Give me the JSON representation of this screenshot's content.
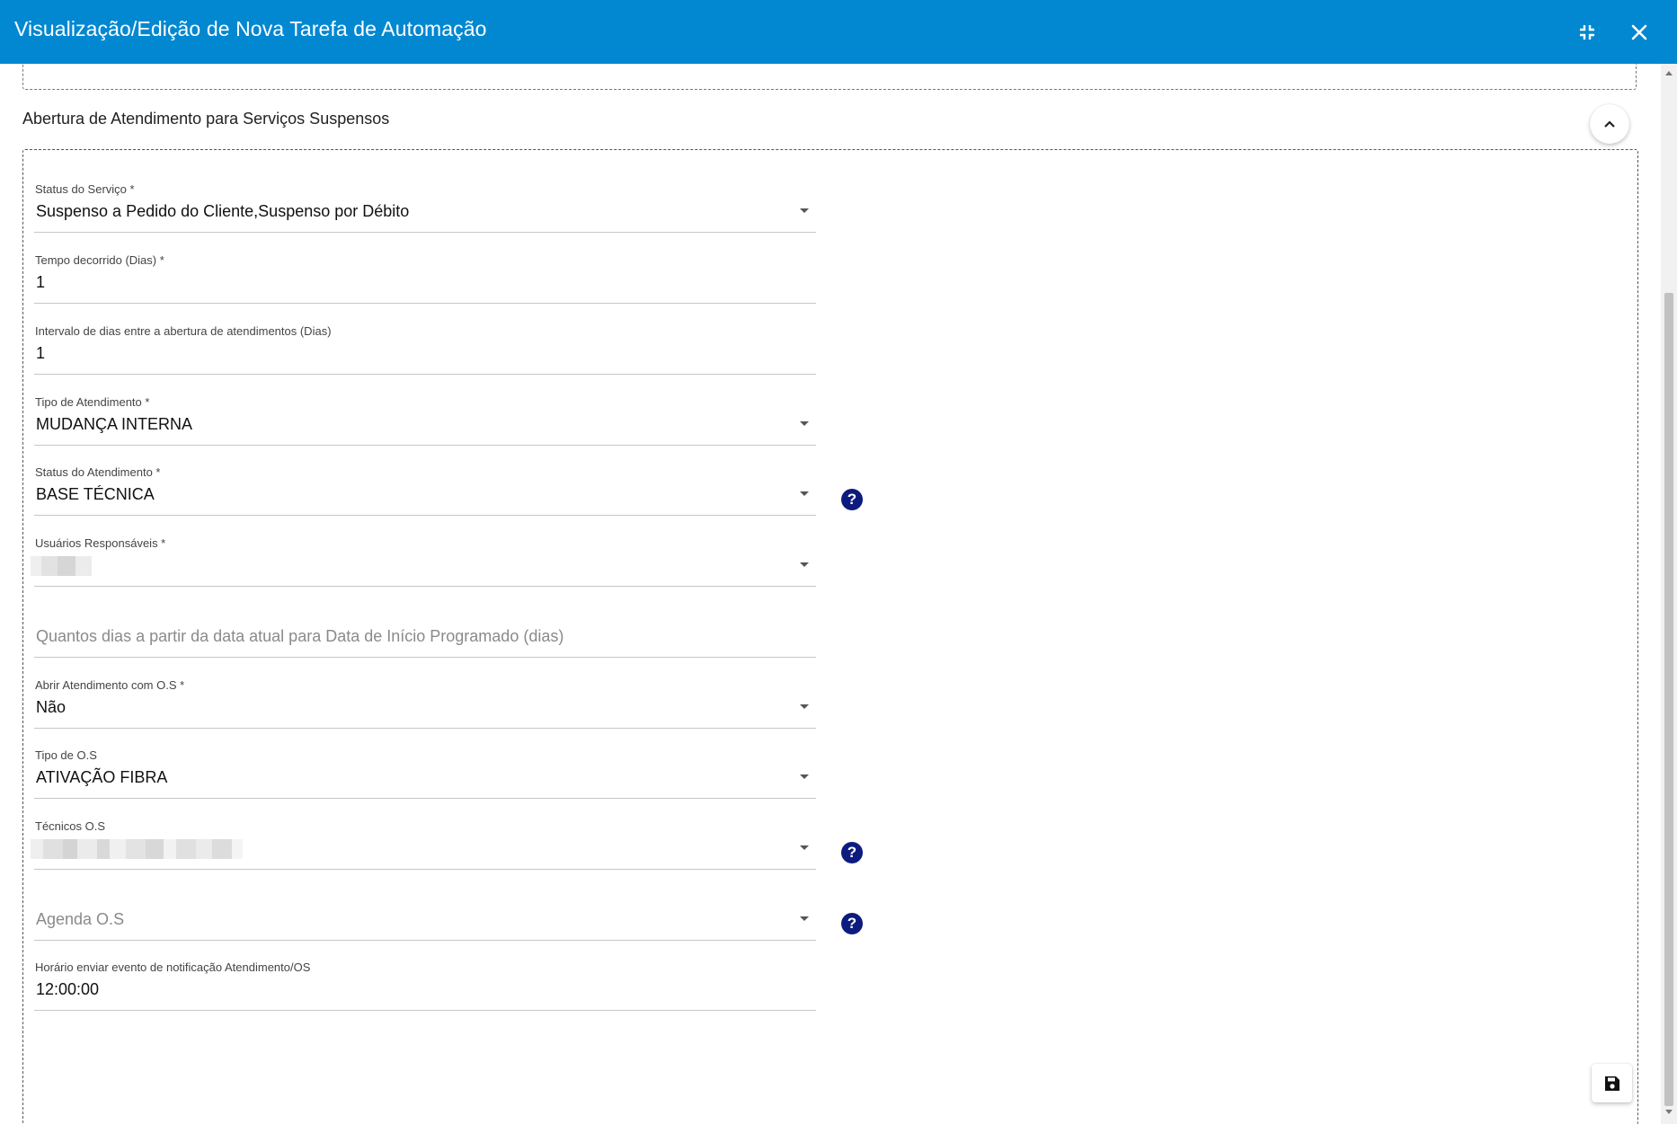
{
  "window": {
    "title": "Visualização/Edição de Nova Tarefa de Automação",
    "header_color": "#0288d1",
    "icons": [
      "compress-icon",
      "close-icon"
    ]
  },
  "section": {
    "title": "Abertura de Atendimento para Serviços Suspensos"
  },
  "fields": {
    "status_servico": {
      "label": "Status do Serviço *",
      "value": "Suspenso a Pedido do Cliente,Suspenso por Débito"
    },
    "tempo_decorrido": {
      "label": "Tempo decorrido (Dias) *",
      "value": "1"
    },
    "intervalo_dias": {
      "label": "Intervalo de dias entre a abertura de atendimentos (Dias)",
      "value": "1"
    },
    "tipo_atendimento": {
      "label": "Tipo de Atendimento *",
      "value": "MUDANÇA INTERNA"
    },
    "status_atendimento": {
      "label": "Status do Atendimento *",
      "value": "BASE TÉCNICA"
    },
    "usuarios_responsaveis": {
      "label": "Usuários Responsáveis *",
      "value": ""
    },
    "dias_inicio_programado": {
      "placeholder": "Quantos dias a partir da data atual para Data de Início Programado (dias)"
    },
    "abrir_com_os": {
      "label": "Abrir Atendimento com O.S *",
      "value": "Não"
    },
    "tipo_os": {
      "label": "Tipo de O.S",
      "value": "ATIVAÇÃO FIBRA"
    },
    "tecnicos_os": {
      "label": "Técnicos O.S",
      "value": ""
    },
    "agenda_os": {
      "placeholder": "Agenda O.S"
    },
    "horario_notificacao": {
      "label": "Horário enviar evento de notificação Atendimento/OS",
      "value": "12:00:00"
    }
  },
  "help_icon_color": "#0d1b7e",
  "help_glyph": "?"
}
